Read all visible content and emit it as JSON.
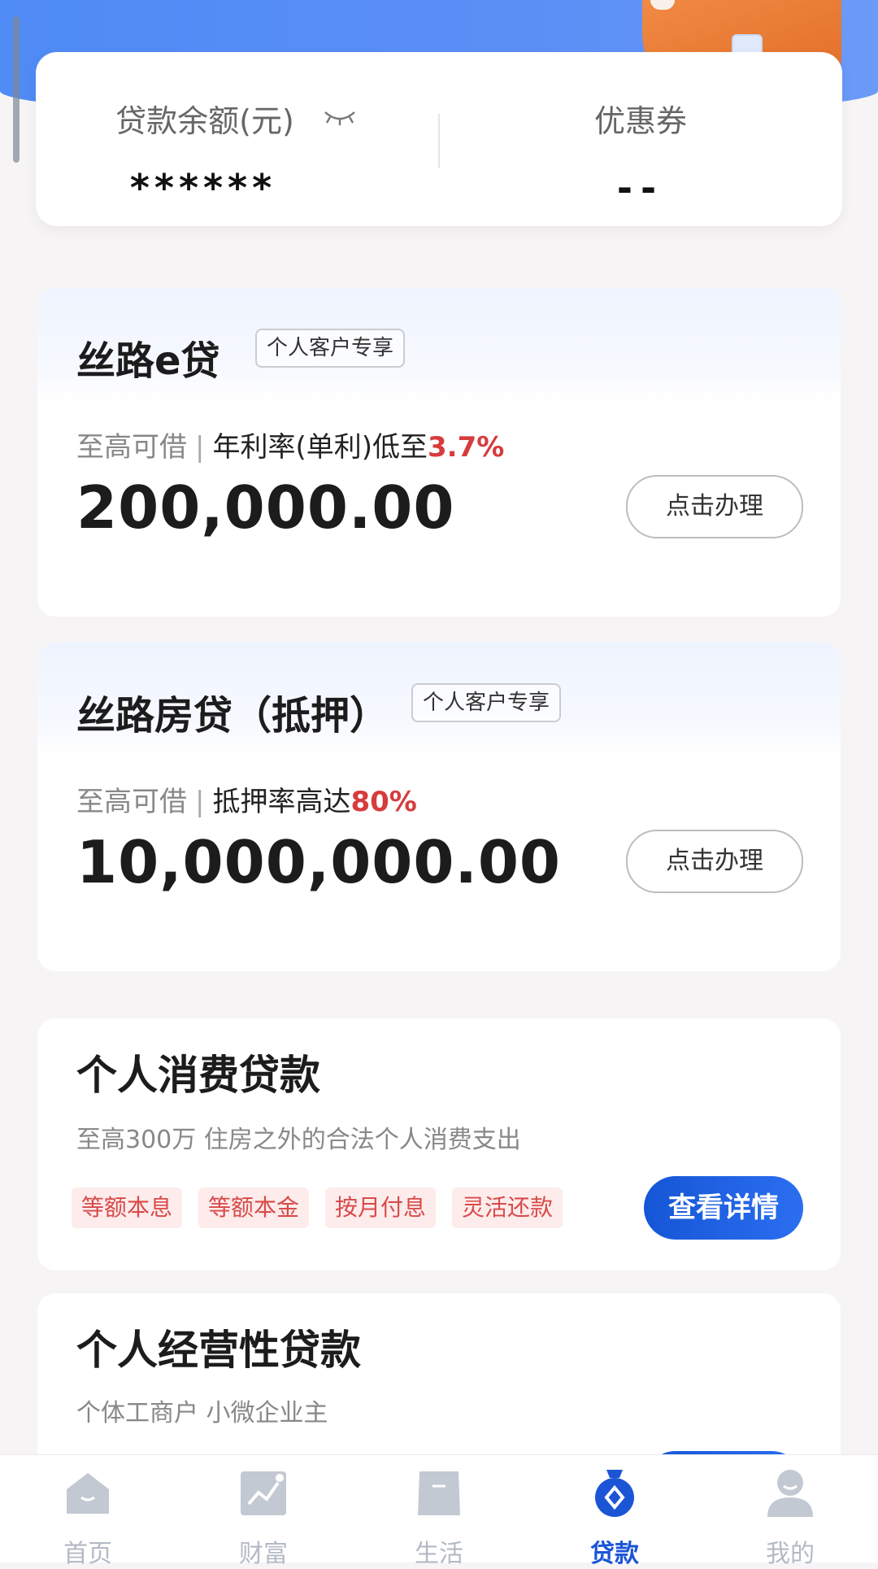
{
  "summary": {
    "loan_balance_label": "贷款余额(元)",
    "loan_balance_value": "******",
    "coupon_label": "优惠券",
    "coupon_value": "--"
  },
  "products": [
    {
      "title": "丝路e贷",
      "tag": "个人客户专享",
      "sub_prefix": "至高可借",
      "sub_sep": "|",
      "sub_text": "年利率(单利)低至",
      "sub_highlight": "3.7%",
      "amount": "200,000.00",
      "button": "点击办理"
    },
    {
      "title": "丝路房贷（抵押）",
      "tag": "个人客户专享",
      "sub_prefix": "至高可借",
      "sub_sep": "|",
      "sub_text": "抵押率高达",
      "sub_highlight": "80%",
      "amount": "10,000,000.00",
      "button": "点击办理"
    }
  ],
  "consumer_loan": {
    "title": "个人消费贷款",
    "desc": "至高300万 住房之外的合法个人消费支出",
    "chips": [
      "等额本息",
      "等额本金",
      "按月付息",
      "灵活还款"
    ],
    "button": "查看详情"
  },
  "business_loan": {
    "title": "个人经营性贷款",
    "desc": "个体工商户 小微企业主"
  },
  "tabbar": [
    {
      "label": "首页",
      "icon": "home-icon"
    },
    {
      "label": "财富",
      "icon": "wealth-chart-icon"
    },
    {
      "label": "生活",
      "icon": "life-bag-icon"
    },
    {
      "label": "贷款",
      "icon": "loan-moneybag-icon"
    },
    {
      "label": "我的",
      "icon": "profile-icon"
    }
  ],
  "colors": {
    "accent_blue": "#1b55d6",
    "highlight_red": "#d63c3c",
    "hero_blue": "#5b8ff6"
  }
}
